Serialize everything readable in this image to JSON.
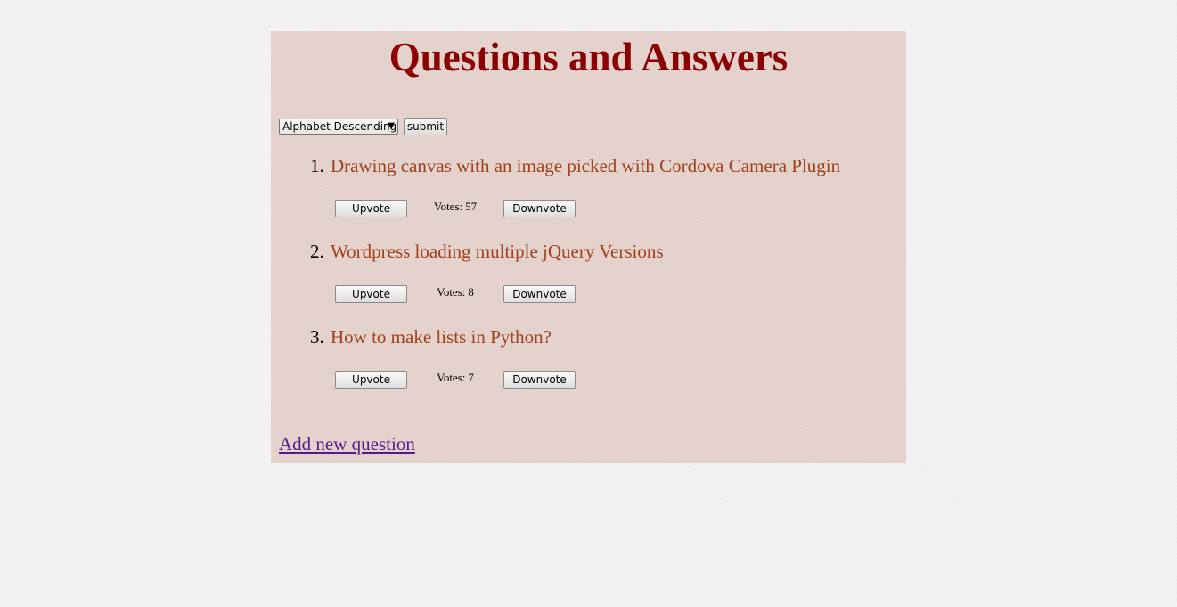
{
  "page_title": "Questions and Answers",
  "sort": {
    "selected": "Alphabet Descending",
    "submit_label": "submit"
  },
  "vote_labels": {
    "upvote": "Upvote",
    "downvote": "Downvote",
    "votes_prefix": "Votes:"
  },
  "questions": [
    {
      "number": "1.",
      "title": "Drawing canvas with an image picked with Cordova Camera Plugin",
      "votes": "57"
    },
    {
      "number": "2.",
      "title": "Wordpress loading multiple jQuery Versions",
      "votes": "8"
    },
    {
      "number": "3.",
      "title": "How to make lists in Python?",
      "votes": "7"
    }
  ],
  "add_question_label": "Add new question",
  "colors": {
    "title": "#8b0000",
    "question_link": "#a0401a",
    "visited_link": "#551a8b",
    "panel_background": "#e5d2cc"
  }
}
